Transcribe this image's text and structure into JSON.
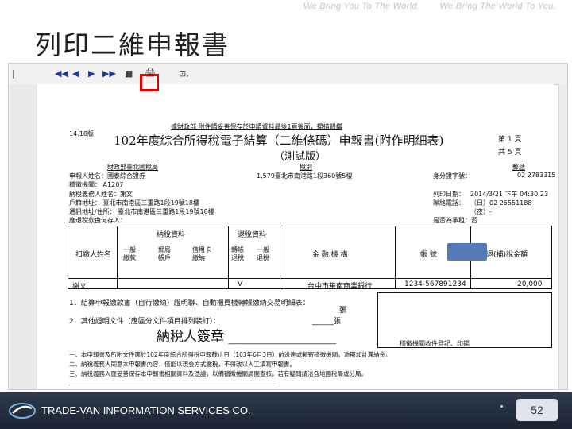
{
  "tagline": [
    "We Bring You To The World.",
    "We Bring The World To You."
  ],
  "slide_title": "列印二維申報書",
  "toolbar": {
    "nav_first": "◀◀",
    "nav_prev": "◀",
    "nav_next": "▶",
    "nav_last": "▶▶",
    "sep": "|",
    "zoom": "■",
    "print": "🖨",
    "misc": "⊡,"
  },
  "doc": {
    "stamp_line": "據財政部 附件請妥善保存於申請資料最後1頁後面，掃描歸檔",
    "version": "14.18版",
    "main_title": "102年度綜合所得稅電子結算（二維條碼）申報書(附作明細表)",
    "page_info": "第 1  頁",
    "page_total": "共 5  頁",
    "test_label": "（測試版）",
    "agency_label": "財政部臺北國稅局",
    "tax_office": "稅別",
    "address_label": "1,579臺北市南港路1段360號5樓",
    "id_label": "身分證字號：",
    "code_label": "郵遞",
    "id_value": "02 2783315",
    "name_row1": "申報人姓名：國泰綜合證券",
    "name_row2": "稽徵機關：  A1207",
    "name_row3": "納稅義務人姓名：謝文",
    "addr_row": "戶籍地址： 臺北市南港區三重路1段19號18樓",
    "contact_row": "通訊地址/住所： 臺北市南港區三重路1段19號18樓",
    "print_date_label": "列印日期：",
    "print_date_value": "2014/3/21 下午 04:30:23",
    "phone_label": "聯絡電話：",
    "phone_value": "（日）02 26551188",
    "phone_night": "（夜）-",
    "refund_label": "應退稅款由何存入：",
    "yes_no": "是否為承租：否",
    "table_headers": [
      "扣繳人姓名",
      "納稅資料",
      "退稅資料",
      "金 融 機 構",
      "帳 號",
      "應退(補)稅金額"
    ],
    "sub_headers": [
      "一般\n繳款",
      "郵局\n帳戶",
      "信用卡\n繳納",
      "轉帳\n退稅",
      "一般\n退稅"
    ],
    "row_name": "謝文",
    "row_mark": "V",
    "row_bank": "台中市華南商業銀行",
    "row_account": "1234-567891234",
    "row_amount": "20,000",
    "note1": "1．結算申報繳款書（自行繳納）證明聯、自動櫃員機轉帳繳納交易明細表：",
    "note_num": "張",
    "note2": "2．其他證明文件（應區分文件項目排列裝訂）：",
    "note2_num": "______張",
    "signature_title": "納稅人簽章 ________________",
    "stamp_box": "稽徵機關收件登記、印鑑",
    "footnote1": "一、本申報書及所附文件應於102年度綜合所得稅申報截止日（103年6月3日）前送達或郵寄稽徵機關，逾期加計滯納金。",
    "footnote2": "二、納稅義務人同意本申報書內容，僅能以現金方式繳稅，不得改以人工填寫申報書。",
    "footnote3": "三、納稅義務人應妥善保存本申報書相關資料及憑證，以備稽徵機關調閱查核，若有疑問請洽各地國稅局或分局。"
  },
  "footer": {
    "company": "TRADE-VAN INFORMATION SERVICES CO.",
    "page_number": "52"
  },
  "colors": {
    "highlight": "#e00000",
    "footer_bg": "#1b2433",
    "mask": "#5679b8"
  }
}
